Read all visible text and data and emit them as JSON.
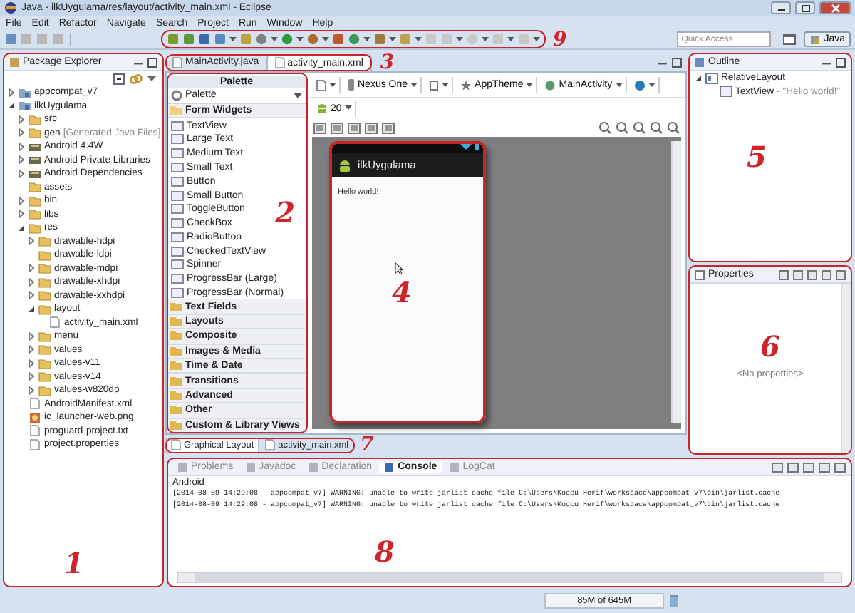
{
  "window": {
    "title": "Java - ilkUygulama/res/layout/activity_main.xml - Eclipse"
  },
  "menu": [
    "File",
    "Edit",
    "Refactor",
    "Navigate",
    "Search",
    "Project",
    "Run",
    "Window",
    "Help"
  ],
  "toolbar": {
    "callout": "9",
    "quick_access": {
      "placeholder": "Quick Access"
    },
    "perspective": "Java"
  },
  "package_explorer": {
    "title": "Package Explorer",
    "callout": "1",
    "tree": [
      {
        "label": "appcompat_v7",
        "kind": "project",
        "expanded": false
      },
      {
        "label": "ilkUygulama",
        "kind": "project",
        "expanded": true,
        "children": [
          {
            "label": "src",
            "kind": "folder",
            "expanded": false
          },
          {
            "label": "gen",
            "note": "[Generated Java Files]",
            "kind": "folder",
            "expanded": false
          },
          {
            "label": "Android 4.4W",
            "kind": "library",
            "expanded": false
          },
          {
            "label": "Android Private Libraries",
            "kind": "library",
            "expanded": false
          },
          {
            "label": "Android Dependencies",
            "kind": "library",
            "expanded": false
          },
          {
            "label": "assets",
            "kind": "folder"
          },
          {
            "label": "bin",
            "kind": "folder",
            "expanded": false
          },
          {
            "label": "libs",
            "kind": "folder",
            "expanded": false
          },
          {
            "label": "res",
            "kind": "folder",
            "expanded": true,
            "children": [
              {
                "label": "drawable-hdpi",
                "kind": "folder",
                "expanded": false
              },
              {
                "label": "drawable-ldpi",
                "kind": "folder"
              },
              {
                "label": "drawable-mdpi",
                "kind": "folder",
                "expanded": false
              },
              {
                "label": "drawable-xhdpi",
                "kind": "folder",
                "expanded": false
              },
              {
                "label": "drawable-xxhdpi",
                "kind": "folder",
                "expanded": false
              },
              {
                "label": "layout",
                "kind": "folder",
                "expanded": true,
                "children": [
                  {
                    "label": "activity_main.xml",
                    "kind": "file"
                  }
                ]
              },
              {
                "label": "menu",
                "kind": "folder",
                "expanded": false
              },
              {
                "label": "values",
                "kind": "folder",
                "expanded": false
              },
              {
                "label": "values-v11",
                "kind": "folder",
                "expanded": false
              },
              {
                "label": "values-v14",
                "kind": "folder",
                "expanded": false
              },
              {
                "label": "values-w820dp",
                "kind": "folder",
                "expanded": false
              }
            ]
          },
          {
            "label": "AndroidManifest.xml",
            "kind": "file"
          },
          {
            "label": "ic_launcher-web.png",
            "kind": "image"
          },
          {
            "label": "proguard-project.txt",
            "kind": "file"
          },
          {
            "label": "project.properties",
            "kind": "file"
          }
        ]
      }
    ]
  },
  "editor_tabs": {
    "callout": "3",
    "tabs": [
      {
        "label": "MainActivity.java",
        "selected": false
      },
      {
        "label": "activity_main.xml",
        "selected": true
      }
    ]
  },
  "palette": {
    "title": "Palette",
    "dropdown": "Palette",
    "callout": "2",
    "groups": [
      {
        "label": "Form Widgets",
        "expanded": true,
        "items": [
          "TextView",
          "Large Text",
          "Medium Text",
          "Small Text",
          "Button",
          "Small Button",
          "ToggleButton",
          "CheckBox",
          "RadioButton",
          "CheckedTextView",
          "Spinner",
          "ProgressBar (Large)",
          "ProgressBar (Normal)"
        ]
      },
      {
        "label": "Text Fields",
        "expanded": false
      },
      {
        "label": "Layouts",
        "expanded": false
      },
      {
        "label": "Composite",
        "expanded": false
      },
      {
        "label": "Images & Media",
        "expanded": false
      },
      {
        "label": "Time & Date",
        "expanded": false
      },
      {
        "label": "Transitions",
        "expanded": false
      },
      {
        "label": "Advanced",
        "expanded": false
      },
      {
        "label": "Other",
        "expanded": false
      },
      {
        "label": "Custom & Library Views",
        "expanded": false
      }
    ]
  },
  "layout_toolbar": {
    "device": "Nexus One",
    "theme": "AppTheme",
    "activity": "MainActivity",
    "api": "20"
  },
  "preview": {
    "callout": "4",
    "app_title": "ilkUygulama",
    "text": "Hello world!"
  },
  "editor_bottom_tabs": {
    "callout": "7",
    "tabs": [
      {
        "label": "Graphical Layout",
        "selected": true
      },
      {
        "label": "activity_main.xml",
        "selected": false
      }
    ]
  },
  "outline": {
    "title": "Outline",
    "callout": "5",
    "tree": [
      {
        "label": "RelativeLayout",
        "kind": "layout",
        "expanded": true,
        "children": [
          {
            "label": "TextView",
            "note": "- \"Hello world!\"",
            "kind": "widget"
          }
        ]
      }
    ]
  },
  "properties": {
    "title": "Properties",
    "callout": "6",
    "empty": "<No properties>"
  },
  "console": {
    "callout": "8",
    "tabs": [
      {
        "label": "Problems",
        "selected": false
      },
      {
        "label": "Javadoc",
        "selected": false
      },
      {
        "label": "Declaration",
        "selected": false
      },
      {
        "label": "Console",
        "selected": true
      },
      {
        "label": "LogCat",
        "selected": false
      }
    ],
    "name": "Android",
    "lines": [
      "[2014-08-09 14:29:08 - appcompat_v7] WARNING: unable to write jarlist cache file C:\\Users\\Kodcu Herif\\workspace\\appcompat_v7\\bin\\jarlist.cache",
      "[2014-08-09 14:29:08 - appcompat_v7] WARNING: unable to write jarlist cache file C:\\Users\\Kodcu Herif\\workspace\\appcompat_v7\\bin\\jarlist.cache"
    ]
  },
  "status_bar": {
    "memory": "85M of 645M"
  }
}
